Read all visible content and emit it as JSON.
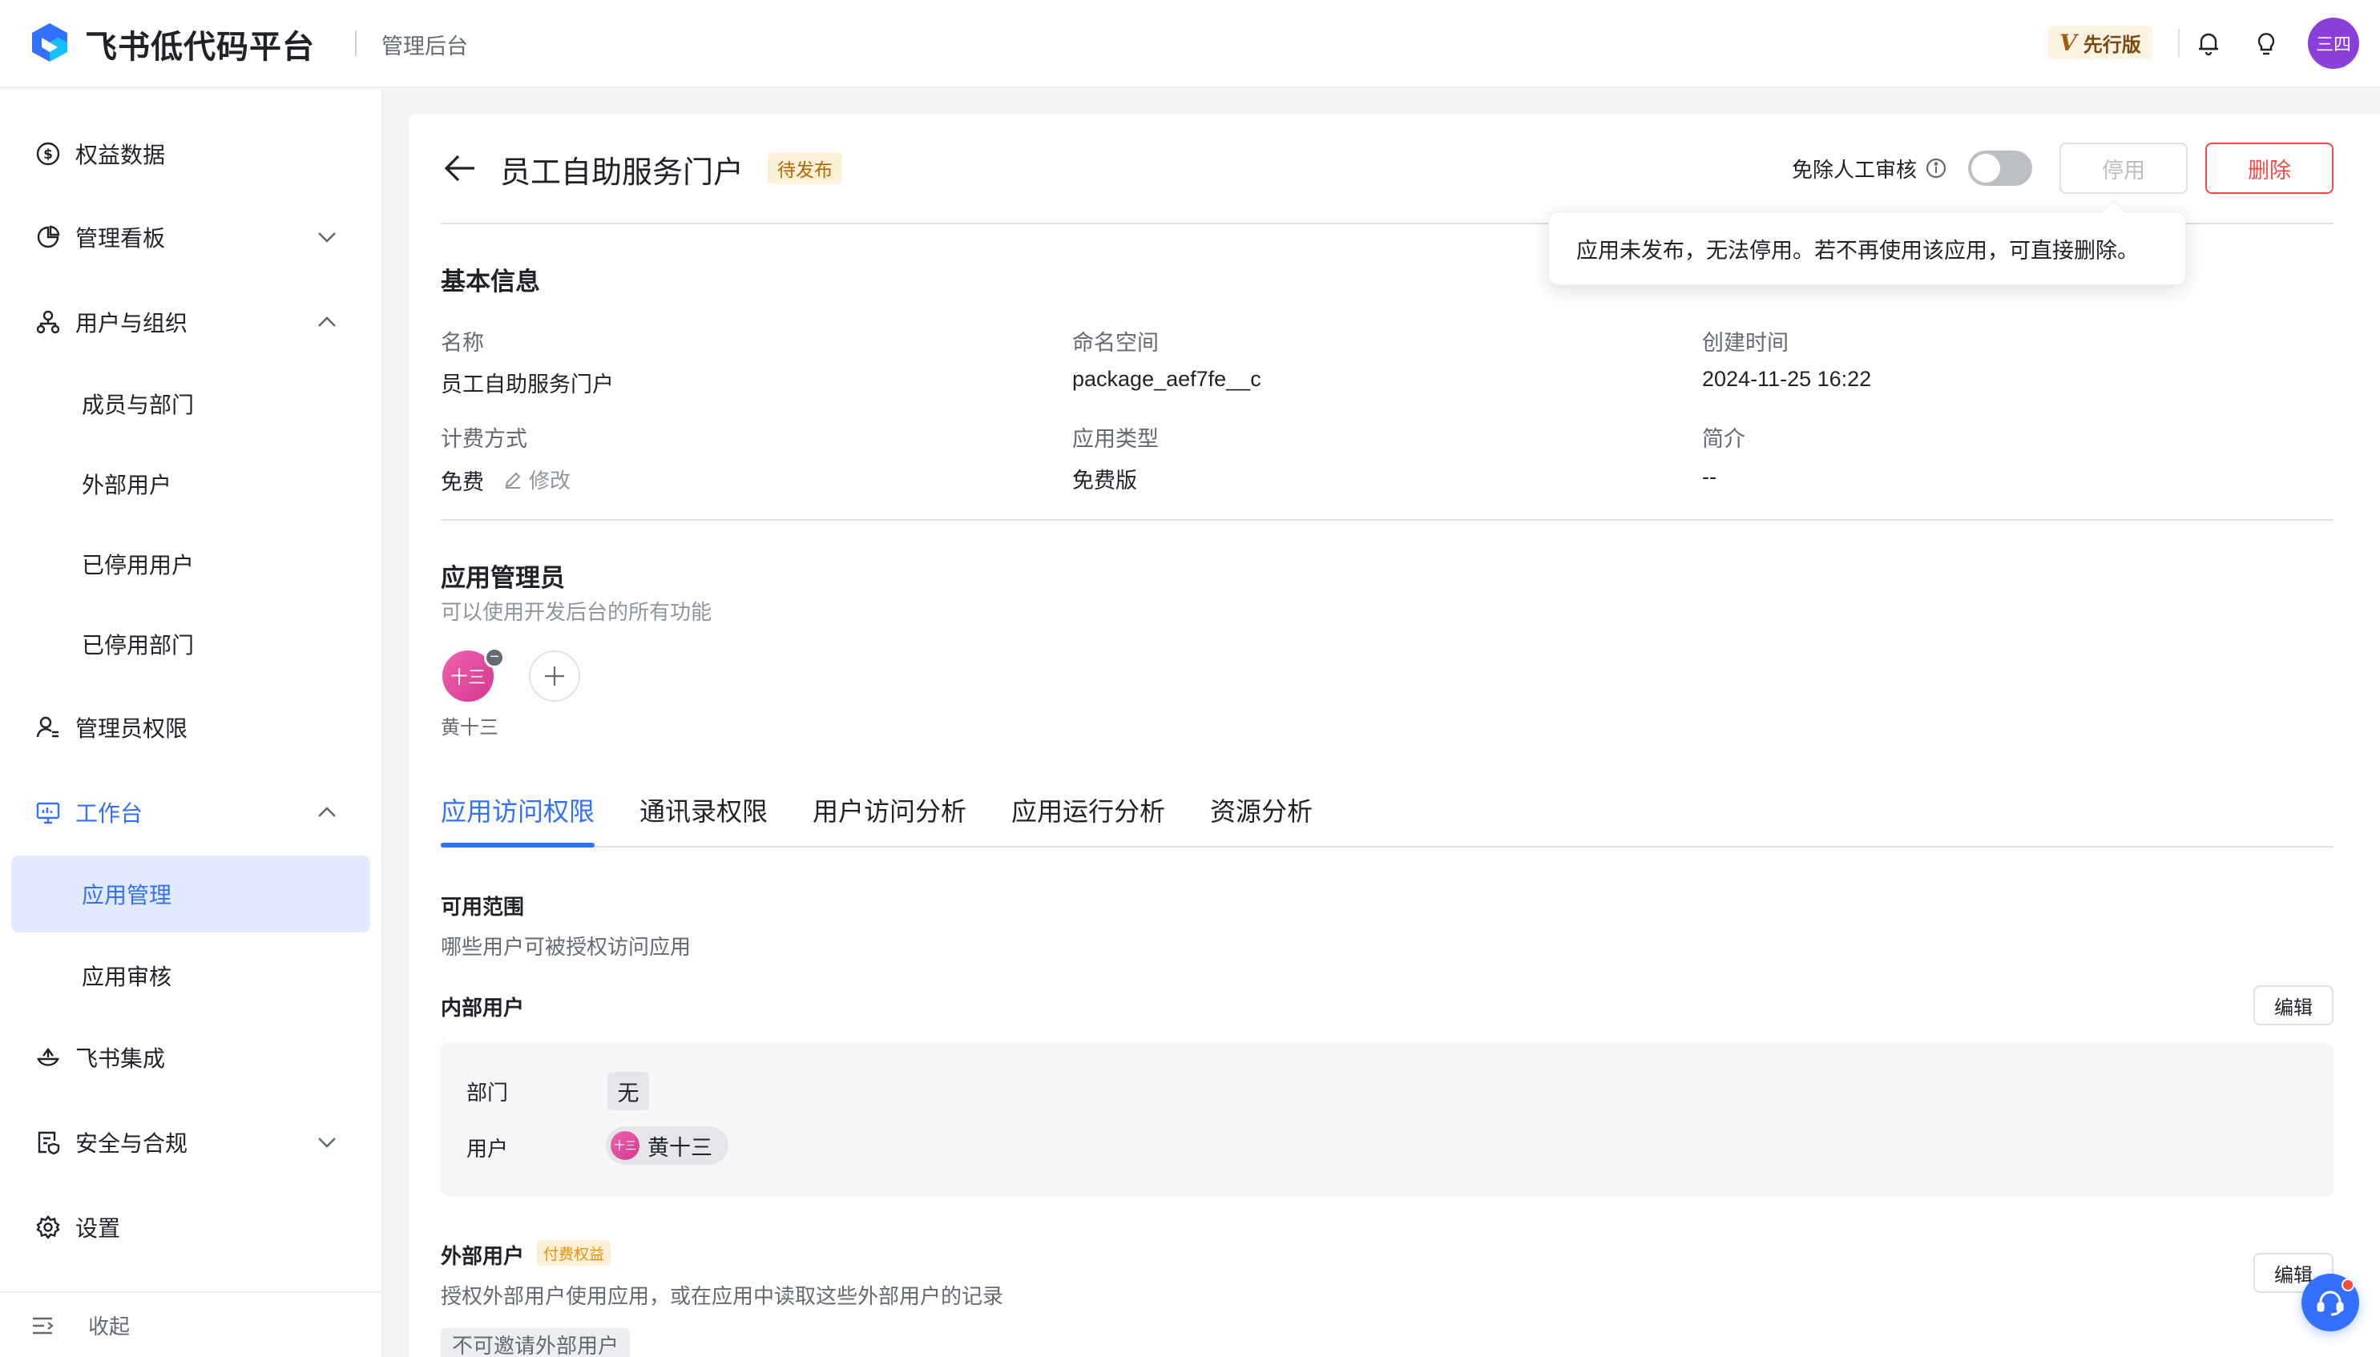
{
  "header": {
    "brand_title": "飞书低代码平台",
    "brand_subtitle": "管理后台",
    "version_badge": "先行版",
    "version_letter": "V",
    "avatar_text": "三四"
  },
  "sidebar": {
    "items": [
      {
        "label": "权益数据",
        "icon": "dollar-circle-icon"
      },
      {
        "label": "管理看板",
        "icon": "pie-chart-icon",
        "expanded": false
      },
      {
        "label": "用户与组织",
        "icon": "org-tree-icon",
        "expanded": true
      },
      {
        "label": "成员与部门"
      },
      {
        "label": "外部用户"
      },
      {
        "label": "已停用用户"
      },
      {
        "label": "已停用部门"
      },
      {
        "label": "管理员权限",
        "icon": "admin-user-icon"
      },
      {
        "label": "工作台",
        "icon": "monitor-icon",
        "expanded": true
      },
      {
        "label": "应用管理",
        "selected": true
      },
      {
        "label": "应用审核"
      },
      {
        "label": "飞书集成",
        "icon": "integration-icon"
      },
      {
        "label": "安全与合规",
        "icon": "security-doc-icon",
        "expanded": false
      },
      {
        "label": "设置",
        "icon": "gear-icon"
      }
    ],
    "collapse_label": "收起"
  },
  "page": {
    "title": "员工自助服务门户",
    "status_tag": "待发布",
    "review_label": "免除人工审核",
    "review_toggle_on": false,
    "disable_button": "停用",
    "delete_button": "删除",
    "tooltip": "应用未发布，无法停用。若不再使用该应用，可直接删除。"
  },
  "basic_info": {
    "title": "基本信息",
    "fields": {
      "name_label": "名称",
      "name_value": "员工自助服务门户",
      "namespace_label": "命名空间",
      "namespace_value": "package_aef7fe__c",
      "created_label": "创建时间",
      "created_value": "2024-11-25 16:22",
      "billing_label": "计费方式",
      "billing_value": "免费",
      "billing_edit": "修改",
      "apptype_label": "应用类型",
      "apptype_value": "免费版",
      "intro_label": "简介",
      "intro_value": "--"
    }
  },
  "admins": {
    "title": "应用管理员",
    "description": "可以使用开发后台的所有功能",
    "avatar_text": "十三",
    "admin_name": "黄十三"
  },
  "tabs": [
    "应用访问权限",
    "通讯录权限",
    "用户访问分析",
    "应用运行分析",
    "资源分析"
  ],
  "access": {
    "scope_title": "可用范围",
    "scope_desc": "哪些用户可被授权访问应用",
    "internal_title": "内部用户",
    "edit_label": "编辑",
    "dept_label": "部门",
    "dept_value": "无",
    "user_label": "用户",
    "user_avatar_text": "十三",
    "user_value": "黄十三",
    "external_title": "外部用户",
    "paid_tag": "付费权益",
    "external_desc": "授权外部用户使用应用，或在应用中读取这些外部用户的记录",
    "external_edit_label": "编辑",
    "no_invite": "不可邀请外部用户"
  },
  "colors": {
    "accent": "#3370ff",
    "danger": "#f54a45",
    "warning_bg": "#fdf0d9"
  }
}
